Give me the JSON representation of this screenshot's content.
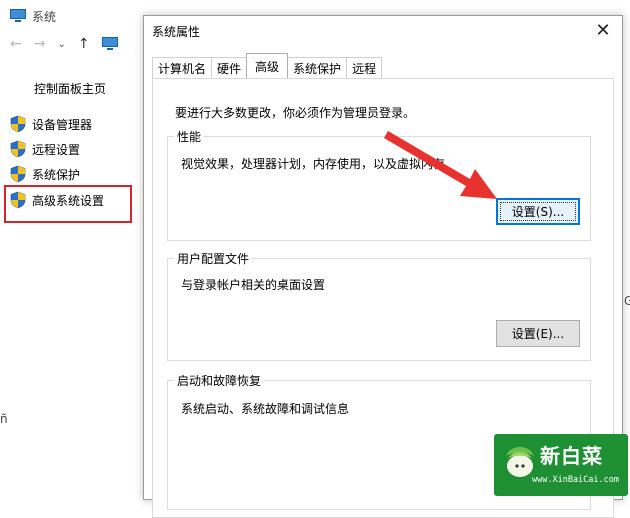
{
  "background_window": {
    "title": "系统",
    "control_panel_home": "控制面板主页",
    "sidebar_links": [
      {
        "label": "设备管理器",
        "icon": "uac-shield-icon"
      },
      {
        "label": "远程设置",
        "icon": "uac-shield-icon"
      },
      {
        "label": "系统保护",
        "icon": "uac-shield-icon"
      },
      {
        "label": "高级系统设置",
        "icon": "uac-shield-icon",
        "highlighted": true
      }
    ],
    "highlight_color": "#d4262b"
  },
  "dialog": {
    "title": "系统属性",
    "close_glyph": "✕",
    "tabs": [
      "计算机名",
      "硬件",
      "高级",
      "系统保护",
      "远程"
    ],
    "active_tab": "高级",
    "admin_notice": "要进行大多数更改，你必须作为管理员登录。",
    "groups": {
      "performance": {
        "label": "性能",
        "description": "视觉效果，处理器计划，内存使用，以及虚拟内存",
        "button": "设置(S)..."
      },
      "user_profiles": {
        "label": "用户配置文件",
        "description": "与登录帐户相关的桌面设置",
        "button": "设置(E)..."
      },
      "startup_recovery": {
        "label": "启动和故障恢复",
        "description": "系统启动、系统故障和调试信息"
      }
    }
  },
  "watermark": {
    "name": "新白菜",
    "url": "www.XinBaiCai.com",
    "brand_color": "#1e8f33"
  },
  "annotation_arrow_color": "#e8322f"
}
